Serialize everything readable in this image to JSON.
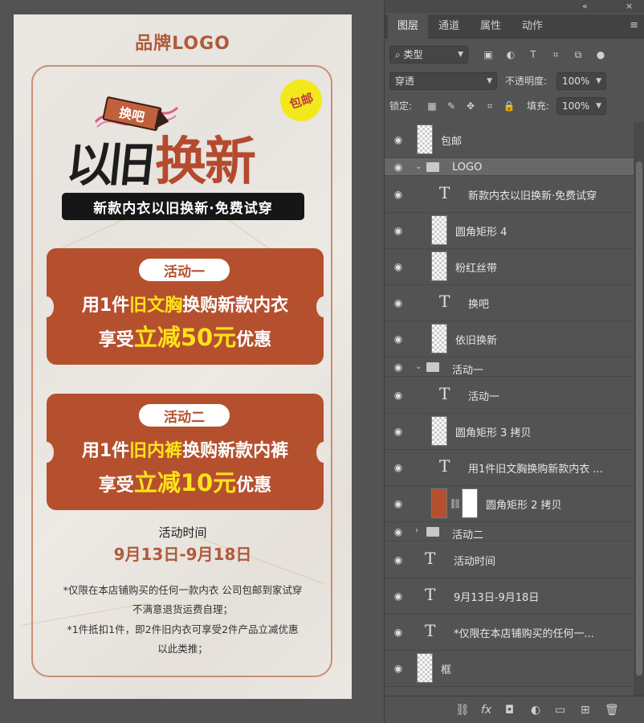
{
  "poster": {
    "brand_logo": "品牌LOGO",
    "free_ship_badge": "包邮",
    "tag_text": "换吧",
    "title_part1": "以旧",
    "title_part2": "换新",
    "subtitle": "新款内衣以旧换新·免费试穿",
    "activity1": {
      "pill": "活动一",
      "line1_a": "用1件",
      "line1_highlight": "旧文胸",
      "line1_b": "换购新款内衣",
      "line2_a": "享受",
      "line2_highlight": "立减50元",
      "line2_b": "优惠"
    },
    "activity2": {
      "pill": "活动二",
      "line1_a": "用1件",
      "line1_highlight": "旧内裤",
      "line1_b": "换购新款内裤",
      "line2_a": "享受",
      "line2_highlight": "立减10元",
      "line2_b": "优惠"
    },
    "time_label": "活动时间",
    "time_range": "9月13日-9月18日",
    "notes": [
      "*仅限在本店铺购买的任何一款内衣 公司包邮到家试穿",
      "不满意退货运费自理；",
      "*1件抵扣1件，即2件旧内衣可享受2件产品立减优惠",
      "以此类推；"
    ],
    "colors": {
      "accent": "#b5502f",
      "highlight": "#ffe21a",
      "badge": "#f3e81b"
    }
  },
  "panel": {
    "tabs": [
      "图层",
      "通道",
      "属性",
      "动作"
    ],
    "menu_icon": "≡",
    "filter_kind": "类型",
    "blend_mode": "穿透",
    "opacity_label": "不透明度:",
    "opacity_value": "100%",
    "lock_label": "锁定:",
    "fill_label": "填充:",
    "fill_value": "100%",
    "layers": [
      {
        "name": "包邮",
        "kind": "pixel"
      },
      {
        "name": "LOGO",
        "kind": "group-open"
      },
      {
        "name": "新款内衣以旧换新·免费试穿",
        "kind": "text"
      },
      {
        "name": "圆角矩形 4",
        "kind": "shape"
      },
      {
        "name": "粉红丝带",
        "kind": "pixel"
      },
      {
        "name": "换吧",
        "kind": "text"
      },
      {
        "name": "依旧换新",
        "kind": "pixel"
      },
      {
        "name": "活动一",
        "kind": "group-open"
      },
      {
        "name": "活动一",
        "kind": "text"
      },
      {
        "name": "圆角矩形 3 拷贝",
        "kind": "shape"
      },
      {
        "name": "用1件旧文胸换购新款内衣 ...",
        "kind": "text"
      },
      {
        "name": "圆角矩形 2 拷贝",
        "kind": "shape-masked"
      },
      {
        "name": "活动二",
        "kind": "group-closed"
      },
      {
        "name": "活动时间",
        "kind": "text"
      },
      {
        "name": "9月13日-9月18日",
        "kind": "text"
      },
      {
        "name": "*仅限在本店铺购买的任何一...",
        "kind": "text"
      },
      {
        "name": "框",
        "kind": "shape"
      }
    ],
    "bottom_icons": [
      "link-icon",
      "fx-icon",
      "mask-icon",
      "adjustment-icon",
      "folder-icon",
      "new-layer-icon",
      "trash-icon"
    ]
  }
}
